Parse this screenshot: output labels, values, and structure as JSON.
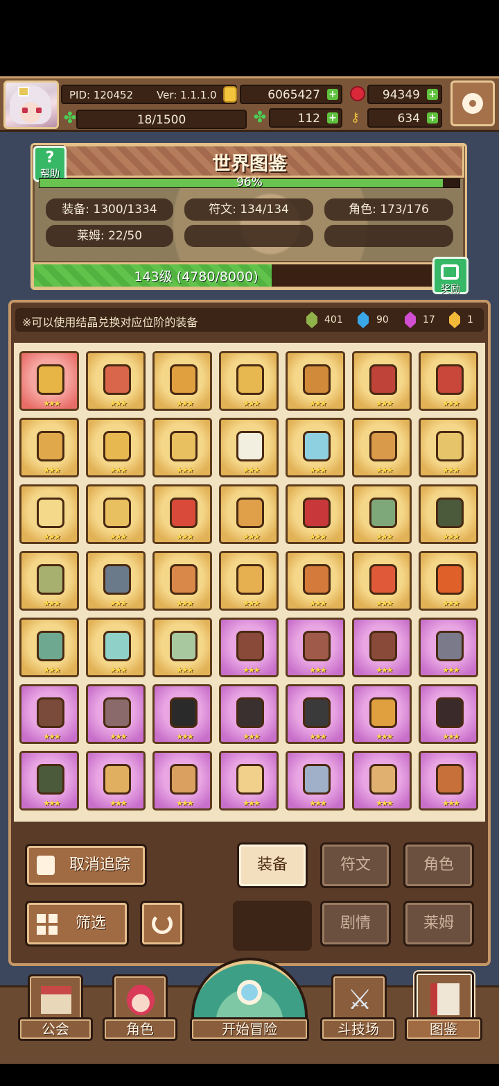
{
  "header": {
    "pid": "PID: 120452",
    "version": "Ver: 1.1.1.0",
    "gold": "6065427",
    "ruby": "94349",
    "stamina": "18/1500",
    "clover": "112",
    "key": "634"
  },
  "world": {
    "title": "世界图鉴",
    "help_label": "帮助",
    "percent": "96%",
    "percent_value": 0.96,
    "stats": {
      "equipment": "装备: 1300/1334",
      "rune": "符文: 134/134",
      "character": "角色: 173/176",
      "slime": "莱姆: 22/50"
    },
    "level_text": "143级 (4780/8000)",
    "level_progress": 0.5975,
    "reward_label": "奖励"
  },
  "notice": {
    "text": "※可以使用结晶兑换对应位阶的装备",
    "crystals": [
      {
        "name": "green-crystal",
        "color": "#8fb24a",
        "count": "401"
      },
      {
        "name": "blue-crystal",
        "color": "#3aa8e8",
        "count": "90"
      },
      {
        "name": "purple-crystal",
        "color": "#d04ed0",
        "count": "17"
      },
      {
        "name": "gold-crystal",
        "color": "#f2b83a",
        "count": "1"
      }
    ]
  },
  "grid": {
    "stars": "★★★",
    "items": [
      {
        "rarity": "red",
        "color": "#e6b545",
        "icon": "heart-necklace-icon"
      },
      {
        "rarity": "gold",
        "color": "#d9654a",
        "icon": "gauntlet-icon"
      },
      {
        "rarity": "gold",
        "color": "#e0a040",
        "icon": "ring-icon"
      },
      {
        "rarity": "gold",
        "color": "#e8b850",
        "icon": "necklace-icon"
      },
      {
        "rarity": "gold",
        "color": "#d08a3a",
        "icon": "wand-icon"
      },
      {
        "rarity": "gold",
        "color": "#c0433a",
        "icon": "amulet-icon"
      },
      {
        "rarity": "gold",
        "color": "#c8463a",
        "icon": "armor-icon"
      },
      {
        "rarity": "gold",
        "color": "#e0a84a",
        "icon": "scepter-icon"
      },
      {
        "rarity": "gold",
        "color": "#e8b850",
        "icon": "crown-icon"
      },
      {
        "rarity": "gold",
        "color": "#e9c060",
        "icon": "robe-icon"
      },
      {
        "rarity": "gold",
        "color": "#f2efe0",
        "icon": "star-gem-icon"
      },
      {
        "rarity": "gold",
        "color": "#8fd0e0",
        "icon": "pendant-icon"
      },
      {
        "rarity": "gold",
        "color": "#d99a4a",
        "icon": "helmet-icon"
      },
      {
        "rarity": "gold",
        "color": "#e6c56a",
        "icon": "gauntlets-icon"
      },
      {
        "rarity": "gold",
        "color": "#f4d98a",
        "icon": "cape-icon"
      },
      {
        "rarity": "gold",
        "color": "#e9c060",
        "icon": "chestplate-icon"
      },
      {
        "rarity": "gold",
        "color": "#d94a3a",
        "icon": "collar-icon"
      },
      {
        "rarity": "gold",
        "color": "#e0a04a",
        "icon": "sun-ring-icon"
      },
      {
        "rarity": "gold",
        "color": "#c8383a",
        "icon": "bracer-icon"
      },
      {
        "rarity": "gold",
        "color": "#7fa87a",
        "icon": "sword-icon"
      },
      {
        "rarity": "gold",
        "color": "#4a5a3a",
        "icon": "hood-icon"
      },
      {
        "rarity": "gold",
        "color": "#a8b070",
        "icon": "boot-icon"
      },
      {
        "rarity": "gold",
        "color": "#6a7a8a",
        "icon": "dagger-icon"
      },
      {
        "rarity": "gold",
        "color": "#d9884a",
        "icon": "band-icon"
      },
      {
        "rarity": "gold",
        "color": "#e6b050",
        "icon": "flower-gem-icon"
      },
      {
        "rarity": "gold",
        "color": "#d47a3a",
        "icon": "spear-icon"
      },
      {
        "rarity": "gold",
        "color": "#e05a3a",
        "icon": "ruby-gem-icon"
      },
      {
        "rarity": "gold",
        "color": "#e0602a",
        "icon": "gem-ring-icon"
      },
      {
        "rarity": "gold",
        "color": "#6fa890",
        "icon": "bow-icon"
      },
      {
        "rarity": "gold",
        "color": "#8fd0c8",
        "icon": "vest-icon"
      },
      {
        "rarity": "gold",
        "color": "#a8c8a0",
        "icon": "greaves-icon"
      },
      {
        "rarity": "purple",
        "color": "#8a4a3a",
        "icon": "leather-collar-icon"
      },
      {
        "rarity": "purple",
        "color": "#a05a4a",
        "icon": "leather-armor-icon"
      },
      {
        "rarity": "purple",
        "color": "#8a4a3a",
        "icon": "boots-icon"
      },
      {
        "rarity": "purple",
        "color": "#7a7a8a",
        "icon": "pistol-icon"
      },
      {
        "rarity": "purple",
        "color": "#7a4a3a",
        "icon": "shoe-icon"
      },
      {
        "rarity": "purple",
        "color": "#8a6a6a",
        "icon": "chain-icon"
      },
      {
        "rarity": "purple",
        "color": "#2a2a2a",
        "icon": "dark-helm-icon"
      },
      {
        "rarity": "purple",
        "color": "#3a3030",
        "icon": "dark-cloak-icon"
      },
      {
        "rarity": "purple",
        "color": "#3a3a3a",
        "icon": "dark-glove-icon"
      },
      {
        "rarity": "purple",
        "color": "#e0a040",
        "icon": "ornate-gem-icon"
      },
      {
        "rarity": "purple",
        "color": "#3a2a2a",
        "icon": "dark-necklace-icon"
      },
      {
        "rarity": "purple",
        "color": "#4a5a3a",
        "icon": "jeweled-ring-icon"
      },
      {
        "rarity": "purple",
        "color": "#e0b060",
        "icon": "crystal-necklace-icon"
      },
      {
        "rarity": "purple",
        "color": "#d9a060",
        "icon": "pearl-ring-icon"
      },
      {
        "rarity": "purple",
        "color": "#f0d08a",
        "icon": "diamond-icon"
      },
      {
        "rarity": "purple",
        "color": "#a0b0c8",
        "icon": "short-sword-icon"
      },
      {
        "rarity": "purple",
        "color": "#e0b070",
        "icon": "medallion-icon"
      },
      {
        "rarity": "purple",
        "color": "#c8703a",
        "icon": "ornate-armor-icon"
      }
    ]
  },
  "actions": {
    "untrack": "取消追踪",
    "filter": "筛选",
    "tabs": [
      "装备",
      "符文",
      "角色",
      "剧情",
      "莱姆"
    ]
  },
  "nav": {
    "guild": "公会",
    "character": "角色",
    "adventure": "开始冒险",
    "arena": "斗技场",
    "codex": "图鉴"
  }
}
